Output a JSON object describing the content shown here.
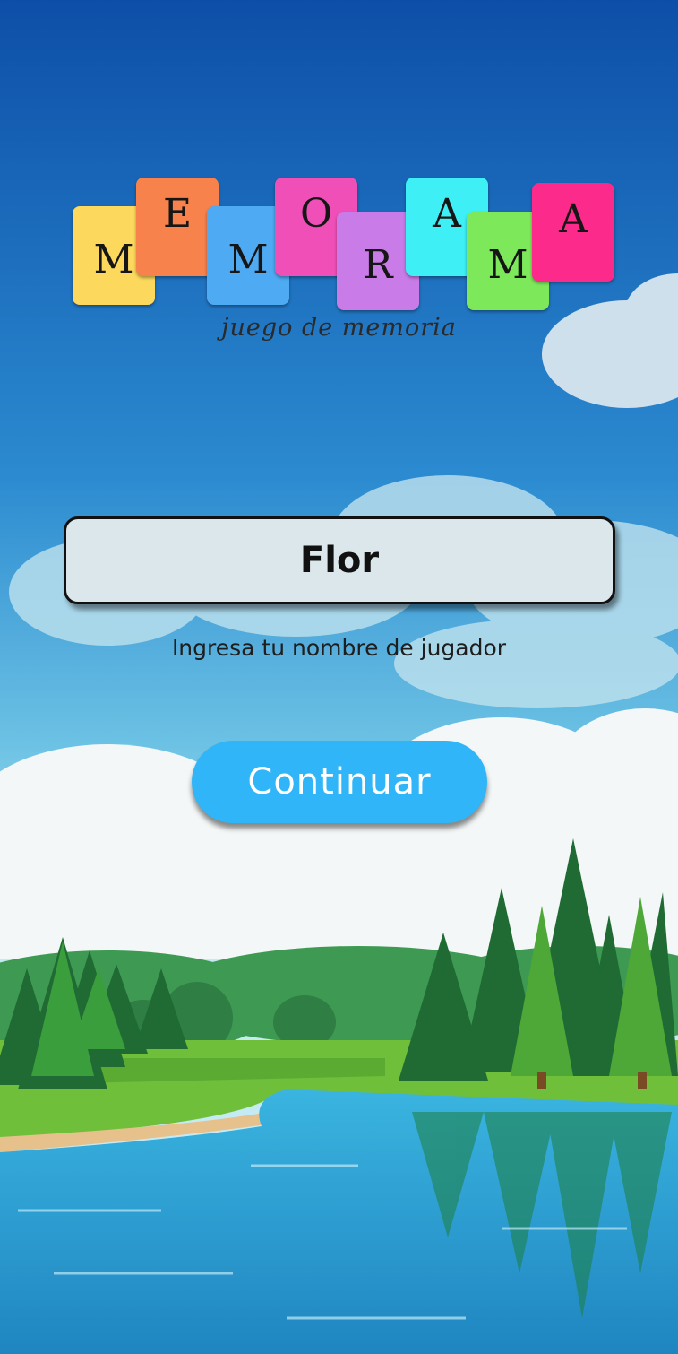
{
  "logo": {
    "letters": [
      "M",
      "E",
      "M",
      "O",
      "R",
      "A",
      "M",
      "A"
    ],
    "tile_colors": [
      "#fcd85c",
      "#f7824c",
      "#4eaaf3",
      "#f04fb8",
      "#c97be8",
      "#3ef0f5",
      "#7de85a",
      "#fc2a8a"
    ],
    "subtitle": "juego de memoria"
  },
  "form": {
    "name_value": "Flor",
    "hint": "Ingresa tu nombre de jugador",
    "continue_label": "Continuar"
  },
  "colors": {
    "sky_top": "#0d4fa8",
    "sky_bottom": "#a8e0ef",
    "button": "#30b5f8",
    "lake": "#2fa3d6"
  }
}
